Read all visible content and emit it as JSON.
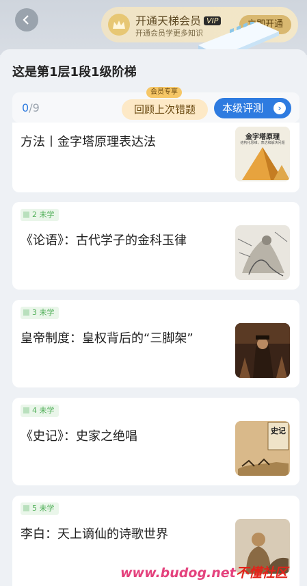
{
  "header": {
    "vip_title": "开通天梯会员",
    "vip_badge": "VIP",
    "vip_sub": "开通会员学更多知识",
    "vip_button": "立即开通"
  },
  "sheet": {
    "title": "这是第1层1段1级阶梯",
    "progress_done": "0",
    "progress_total": "/9",
    "review_tag": "会员专享",
    "review_button": "回顾上次错题",
    "eval_button": "本级评测"
  },
  "cards": [
    {
      "status": "",
      "title": "方法丨金字塔原理表达法",
      "thumb_title": "金字塔原理",
      "thumb_sub": "结构化思维，表达和解决问题"
    },
    {
      "status": "2 未学",
      "title": "《论语》：古代学子的金科玉律"
    },
    {
      "status": "3 未学",
      "title": "皇帝制度：皇权背后的“三脚架”"
    },
    {
      "status": "4 未学",
      "title": "《史记》：史家之绝唱",
      "thumb_title": "史记"
    },
    {
      "status": "5 未学",
      "title": "李白：天上谪仙的诗歌世界"
    }
  ],
  "watermark": {
    "site": "www.budog.net",
    "name": "不懂社区"
  },
  "colors": {
    "accent": "#2e7be0",
    "status_green": "#52b05a",
    "vip_gold": "#d9b870"
  }
}
